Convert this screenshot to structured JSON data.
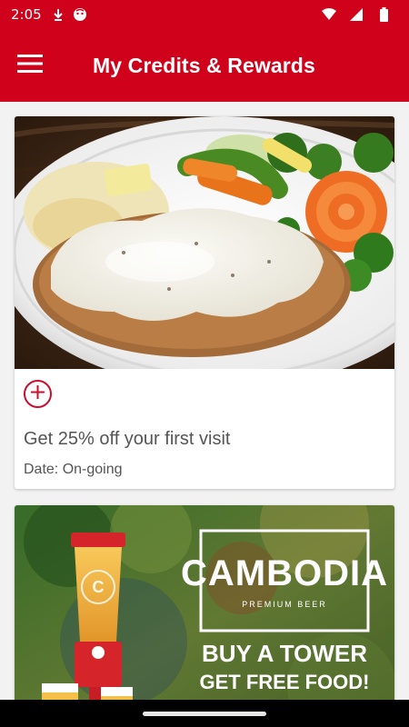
{
  "status_bar": {
    "time": "2:05",
    "icons": [
      "download-arrow-icon",
      "notification-face-icon",
      "wifi-icon",
      "signal-icon",
      "battery-icon"
    ]
  },
  "app_bar": {
    "title": "My Credits & Rewards",
    "menu_icon": "hamburger-menu-icon",
    "background_color": "#d0021b"
  },
  "rewards": [
    {
      "image": "chicken-fried-steak-photo",
      "add_icon": "add-circle-icon",
      "title": "Get 25% off your first visit",
      "date": "Date: On-going"
    },
    {
      "image": "cambodia-beer-promo",
      "promo": {
        "brand": "CAMBODIA",
        "brand_sub": "PREMIUM BEER",
        "line1": "BUY A TOWER",
        "line2": "GET FREE FOOD!"
      }
    }
  ]
}
